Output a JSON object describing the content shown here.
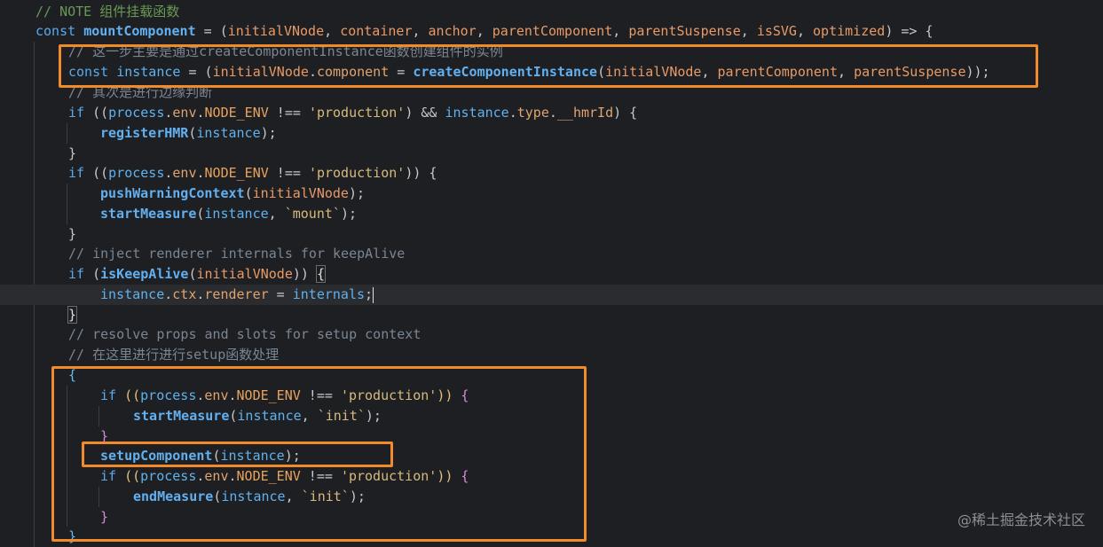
{
  "editor": {
    "lines": [
      [
        [
          "// NOTE 组件挂载函数",
          "note"
        ]
      ],
      [
        [
          "const ",
          "keyword"
        ],
        [
          "mountComponent",
          "fn"
        ],
        [
          " = (",
          "op"
        ],
        [
          "initialVNode",
          "param"
        ],
        [
          ", ",
          "punct"
        ],
        [
          "container",
          "param"
        ],
        [
          ", ",
          "punct"
        ],
        [
          "anchor",
          "param"
        ],
        [
          ", ",
          "punct"
        ],
        [
          "parentComponent",
          "param"
        ],
        [
          ", ",
          "punct"
        ],
        [
          "parentSuspense",
          "param"
        ],
        [
          ", ",
          "punct"
        ],
        [
          "isSVG",
          "param"
        ],
        [
          ", ",
          "punct"
        ],
        [
          "optimized",
          "param"
        ],
        [
          ") => {",
          "op"
        ]
      ],
      [
        [
          "// 这一步主要是通过createComponentInstance函数创建组件的实例",
          "comment"
        ]
      ],
      [
        [
          "const ",
          "keyword"
        ],
        [
          "instance",
          "var"
        ],
        [
          " = (",
          "op"
        ],
        [
          "initialVNode",
          "param"
        ],
        [
          ".",
          "punct"
        ],
        [
          "component",
          "prop"
        ],
        [
          " = ",
          "op"
        ],
        [
          "createComponentInstance",
          "fn"
        ],
        [
          "(",
          "punct"
        ],
        [
          "initialVNode",
          "param"
        ],
        [
          ", ",
          "punct"
        ],
        [
          "parentComponent",
          "param"
        ],
        [
          ", ",
          "punct"
        ],
        [
          "parentSuspense",
          "param"
        ],
        [
          "));",
          "punct"
        ]
      ],
      [
        [
          "// 其次是进行边缘判断",
          "comment"
        ]
      ],
      [
        [
          "if ",
          "keyword"
        ],
        [
          "((",
          "punct"
        ],
        [
          "process",
          "var"
        ],
        [
          ".",
          "punct"
        ],
        [
          "env",
          "prop"
        ],
        [
          ".",
          "punct"
        ],
        [
          "NODE_ENV",
          "const"
        ],
        [
          " !== ",
          "op"
        ],
        [
          "'production'",
          "string"
        ],
        [
          ") && ",
          "punct"
        ],
        [
          "instance",
          "var"
        ],
        [
          ".",
          "punct"
        ],
        [
          "type",
          "prop"
        ],
        [
          ".",
          "punct"
        ],
        [
          "__hmrId",
          "prop"
        ],
        [
          ") {",
          "punct"
        ]
      ],
      [
        [
          "registerHMR",
          "fn"
        ],
        [
          "(",
          "punct"
        ],
        [
          "instance",
          "var"
        ],
        [
          ");",
          "punct"
        ]
      ],
      [
        [
          "}",
          "punct"
        ]
      ],
      [
        [
          "if ",
          "keyword"
        ],
        [
          "((",
          "punct"
        ],
        [
          "process",
          "var"
        ],
        [
          ".",
          "punct"
        ],
        [
          "env",
          "prop"
        ],
        [
          ".",
          "punct"
        ],
        [
          "NODE_ENV",
          "const"
        ],
        [
          " !== ",
          "op"
        ],
        [
          "'production'",
          "string"
        ],
        [
          ")) {",
          "punct"
        ]
      ],
      [
        [
          "pushWarningContext",
          "fn"
        ],
        [
          "(",
          "punct"
        ],
        [
          "initialVNode",
          "param"
        ],
        [
          ");",
          "punct"
        ]
      ],
      [
        [
          "startMeasure",
          "fn"
        ],
        [
          "(",
          "punct"
        ],
        [
          "instance",
          "var"
        ],
        [
          ", ",
          "punct"
        ],
        [
          "`mount`",
          "string"
        ],
        [
          ");",
          "punct"
        ]
      ],
      [
        [
          "}",
          "punct"
        ]
      ],
      [
        [
          "// inject renderer internals for keepAlive",
          "comment"
        ]
      ],
      [
        [
          "if ",
          "keyword"
        ],
        [
          "(",
          "punct"
        ],
        [
          "isKeepAlive",
          "fn"
        ],
        [
          "(",
          "punct"
        ],
        [
          "initialVNode",
          "param"
        ],
        [
          ")) ",
          "punct"
        ],
        [
          "{",
          "bracket"
        ]
      ],
      [
        [
          "instance",
          "var"
        ],
        [
          ".",
          "punct"
        ],
        [
          "ctx",
          "prop"
        ],
        [
          ".",
          "punct"
        ],
        [
          "renderer",
          "prop"
        ],
        [
          " = ",
          "op"
        ],
        [
          "internals",
          "var"
        ],
        [
          ";",
          "punct"
        ],
        [
          "",
          "cursor"
        ]
      ],
      [
        [
          "}",
          "bracket"
        ]
      ],
      [
        [
          "// resolve props and slots for setup context",
          "comment"
        ]
      ],
      [
        [
          "// 在这里进行进行setup函数处理",
          "comment"
        ]
      ],
      [
        [
          "{",
          "brace3"
        ]
      ],
      [
        [
          "if ",
          "keyword"
        ],
        [
          "((",
          "brace"
        ],
        [
          "process",
          "var"
        ],
        [
          ".",
          "punct"
        ],
        [
          "env",
          "prop"
        ],
        [
          ".",
          "punct"
        ],
        [
          "NODE_ENV",
          "const"
        ],
        [
          " !== ",
          "op"
        ],
        [
          "'production'",
          "string"
        ],
        [
          "))",
          "brace"
        ],
        [
          " {",
          "brace2"
        ]
      ],
      [
        [
          "startMeasure",
          "fn"
        ],
        [
          "(",
          "punct"
        ],
        [
          "instance",
          "var"
        ],
        [
          ", ",
          "punct"
        ],
        [
          "`init`",
          "string"
        ],
        [
          ");",
          "punct"
        ]
      ],
      [
        [
          "}",
          "brace2"
        ]
      ],
      [
        [
          "setupComponent",
          "fn"
        ],
        [
          "(",
          "punct"
        ],
        [
          "instance",
          "var"
        ],
        [
          ");",
          "punct"
        ]
      ],
      [
        [
          "if ",
          "keyword"
        ],
        [
          "((",
          "brace"
        ],
        [
          "process",
          "var"
        ],
        [
          ".",
          "punct"
        ],
        [
          "env",
          "prop"
        ],
        [
          ".",
          "punct"
        ],
        [
          "NODE_ENV",
          "const"
        ],
        [
          " !== ",
          "op"
        ],
        [
          "'production'",
          "string"
        ],
        [
          "))",
          "brace"
        ],
        [
          " {",
          "brace2"
        ]
      ],
      [
        [
          "endMeasure",
          "fn"
        ],
        [
          "(",
          "punct"
        ],
        [
          "instance",
          "var"
        ],
        [
          ", ",
          "punct"
        ],
        [
          "`init`",
          "string"
        ],
        [
          ");",
          "punct"
        ]
      ],
      [
        [
          "}",
          "brace2"
        ]
      ],
      [
        [
          "}",
          "brace3"
        ]
      ]
    ]
  },
  "watermark": "@稀土掘金技术社区",
  "colors": {
    "highlight_box": "#f08a2b",
    "background": "#1e1f22"
  }
}
